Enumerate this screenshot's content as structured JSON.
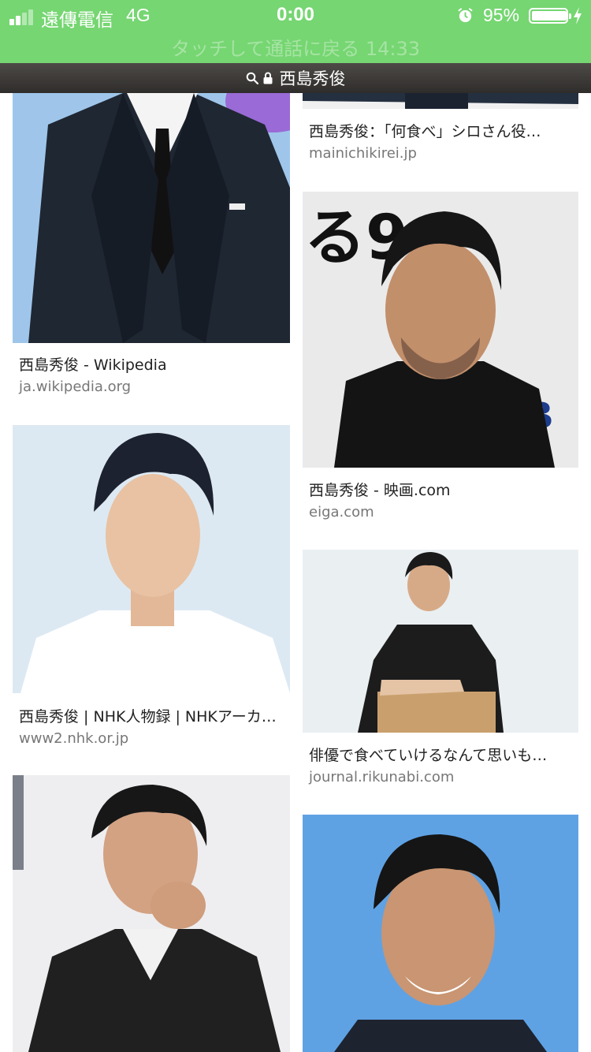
{
  "status_bar": {
    "carrier": "遠傳電信",
    "network": "4G",
    "time": "0:00",
    "battery_percent": "95%",
    "battery_level": 0.95,
    "call_banner": "タッチして通話に戻る 14:33",
    "color": "#76d672"
  },
  "url_bar": {
    "text": "西島秀俊",
    "icons": [
      "search-icon",
      "lock-icon"
    ]
  },
  "results": [
    {
      "title": "西島秀俊 - Wikipedia",
      "source": "ja.wikipedia.org"
    },
    {
      "title": "西島秀俊：「何食べ」シロさん役…",
      "source": "mainichikirei.jp"
    },
    {
      "title": "西島秀俊 - 映画.com",
      "source": "eiga.com"
    },
    {
      "title": "西島秀俊 | NHK人物録 | NHKアーカ…",
      "source": "www2.nhk.or.jp"
    },
    {
      "title": "俳優で食べていけるなんて思いも…",
      "source": "journal.rikunabi.com"
    }
  ],
  "image_text": {
    "eiga_backdrop": "る9",
    "eiga_logo": "TB"
  }
}
